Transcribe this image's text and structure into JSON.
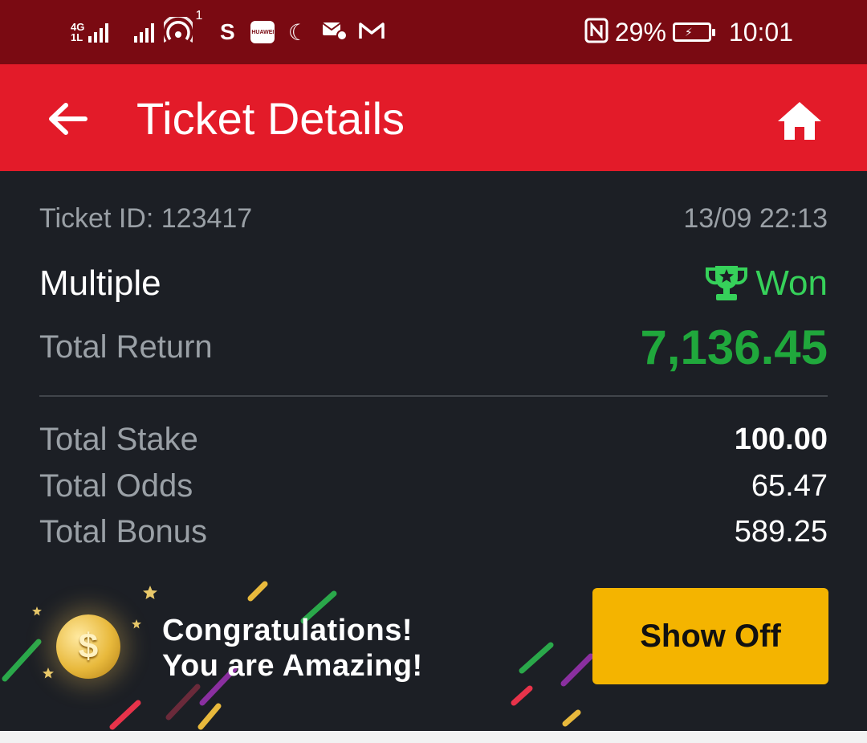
{
  "status_bar": {
    "network_type": "4G",
    "network_sub": "1L",
    "hotspot_count": "1",
    "app_icons": [
      "sportybet-icon",
      "huawei-icon",
      "moon-icon",
      "mail-settings-icon",
      "gmail-icon"
    ],
    "nfc_icon": "nfc-icon",
    "battery_percent": "29%",
    "time": "10:01"
  },
  "app_bar": {
    "title": "Ticket Details",
    "back_icon": "arrow-left-icon",
    "home_icon": "home-icon"
  },
  "ticket": {
    "id_label": "Ticket ID: 123417",
    "date": "13/09 22:13",
    "type": "Multiple",
    "status": "Won",
    "status_icon": "trophy-icon",
    "total_return_label": "Total Return",
    "total_return": "7,136.45",
    "rows": [
      {
        "label": "Total Stake",
        "value": "100.00"
      },
      {
        "label": "Total Odds",
        "value": "65.47"
      },
      {
        "label": "Total Bonus",
        "value": "589.25"
      }
    ]
  },
  "banner": {
    "line1": "Congratulations!",
    "line2": "You are Amazing!",
    "coin_icon": "coin-icon",
    "button_label": "Show Off"
  },
  "colors": {
    "status_bar": "#7a0a12",
    "app_bar": "#e31b29",
    "background": "#1c1f25",
    "won_green": "#36d15a",
    "return_green": "#20a83c",
    "button_yellow": "#f4b400"
  }
}
